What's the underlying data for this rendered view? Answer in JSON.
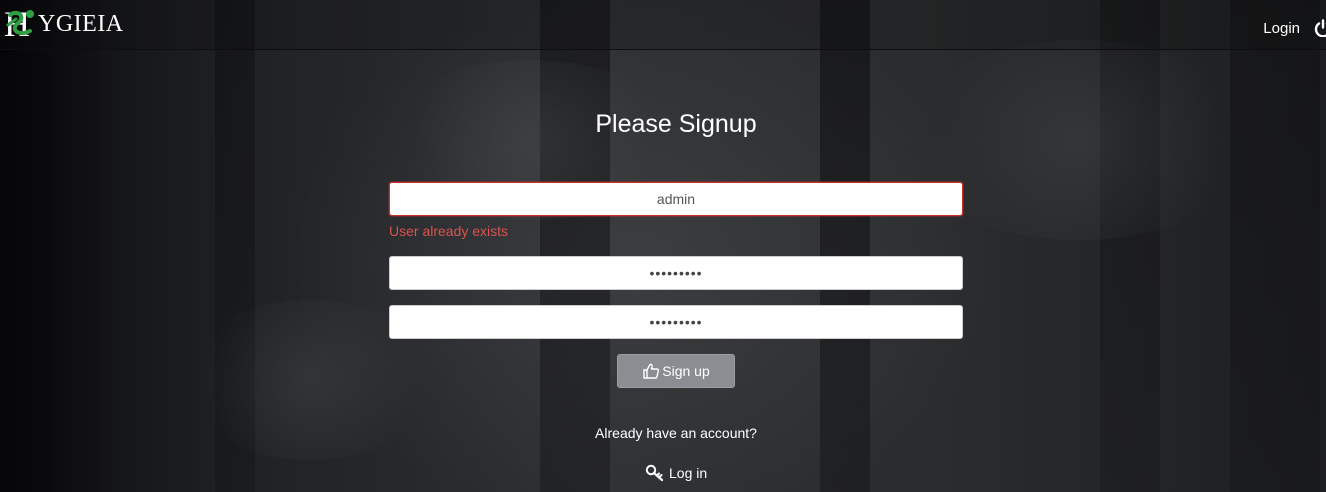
{
  "brand": {
    "name": "YGIEIA",
    "logo_icon": "hygieia-snake-logo-icon",
    "accent": "#2ea043"
  },
  "nav": {
    "login_label": "Login",
    "power_icon": "power-icon"
  },
  "form": {
    "title": "Please Signup",
    "username_value": "admin",
    "error_message": "User already exists",
    "password_value": "•••••••••",
    "confirm_password_value": "•••••••••",
    "signup_label": "Sign up",
    "signup_icon": "thumbs-up-icon"
  },
  "footer": {
    "already_text": "Already have an account?",
    "login_link_label": "Log in",
    "login_icon": "key-icon"
  },
  "colors": {
    "error": "#d9534f",
    "button_bg": "#8a8d91"
  }
}
